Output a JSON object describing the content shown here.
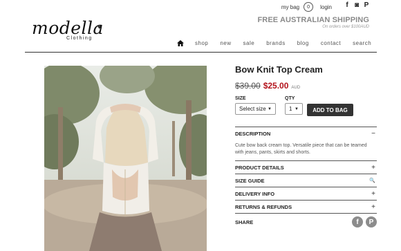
{
  "header": {
    "bag_label": "my bag",
    "bag_count": "0",
    "login_label": "login",
    "social": [
      "f",
      "◙",
      "P"
    ],
    "shipping_title": "FREE AUSTRALIAN SHIPPING",
    "shipping_sub": "On orders over $100AUD"
  },
  "logo": {
    "name": "modella",
    "sub": "Clothing"
  },
  "nav": [
    "shop",
    "new",
    "sale",
    "brands",
    "blog",
    "contact",
    "search"
  ],
  "product": {
    "title": "Bow Knit Top Cream",
    "old_price": "$39.00",
    "price": "$25.00",
    "currency": "AUD",
    "size_label": "SIZE",
    "size_value": "Select size",
    "qty_label": "QTY",
    "qty_value": "1",
    "add_label": "ADD TO BAG"
  },
  "accordion": {
    "description_label": "DESCRIPTION",
    "description_sym": "−",
    "description_text": "Cute bow back cream top. Versatile piece that can be teamed with jeans, pants, skirts and shorts.",
    "items": [
      {
        "label": "PRODUCT DETAILS",
        "sym": "+"
      },
      {
        "label": "SIZE GUIDE",
        "sym": "🔍"
      },
      {
        "label": "DELIVERY INFO",
        "sym": "+"
      },
      {
        "label": "RETURNS & REFUNDS",
        "sym": "+"
      }
    ]
  },
  "share": {
    "label": "SHARE",
    "icons": [
      "f",
      "P"
    ]
  }
}
